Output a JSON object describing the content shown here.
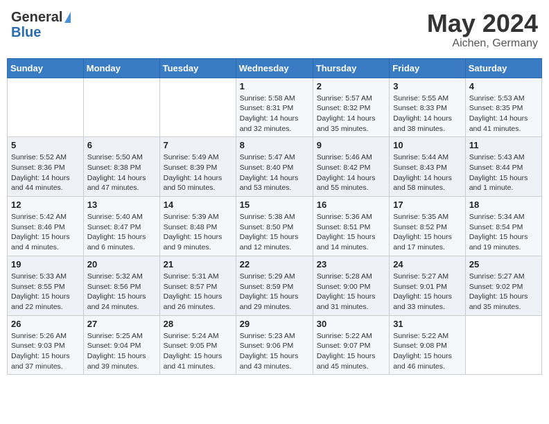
{
  "header": {
    "logo_general": "General",
    "logo_blue": "Blue",
    "month_title": "May 2024",
    "location": "Aichen, Germany"
  },
  "days_of_week": [
    "Sunday",
    "Monday",
    "Tuesday",
    "Wednesday",
    "Thursday",
    "Friday",
    "Saturday"
  ],
  "weeks": [
    [
      {
        "num": "",
        "info": ""
      },
      {
        "num": "",
        "info": ""
      },
      {
        "num": "",
        "info": ""
      },
      {
        "num": "1",
        "info": "Sunrise: 5:58 AM\nSunset: 8:31 PM\nDaylight: 14 hours and 32 minutes."
      },
      {
        "num": "2",
        "info": "Sunrise: 5:57 AM\nSunset: 8:32 PM\nDaylight: 14 hours and 35 minutes."
      },
      {
        "num": "3",
        "info": "Sunrise: 5:55 AM\nSunset: 8:33 PM\nDaylight: 14 hours and 38 minutes."
      },
      {
        "num": "4",
        "info": "Sunrise: 5:53 AM\nSunset: 8:35 PM\nDaylight: 14 hours and 41 minutes."
      }
    ],
    [
      {
        "num": "5",
        "info": "Sunrise: 5:52 AM\nSunset: 8:36 PM\nDaylight: 14 hours and 44 minutes."
      },
      {
        "num": "6",
        "info": "Sunrise: 5:50 AM\nSunset: 8:38 PM\nDaylight: 14 hours and 47 minutes."
      },
      {
        "num": "7",
        "info": "Sunrise: 5:49 AM\nSunset: 8:39 PM\nDaylight: 14 hours and 50 minutes."
      },
      {
        "num": "8",
        "info": "Sunrise: 5:47 AM\nSunset: 8:40 PM\nDaylight: 14 hours and 53 minutes."
      },
      {
        "num": "9",
        "info": "Sunrise: 5:46 AM\nSunset: 8:42 PM\nDaylight: 14 hours and 55 minutes."
      },
      {
        "num": "10",
        "info": "Sunrise: 5:44 AM\nSunset: 8:43 PM\nDaylight: 14 hours and 58 minutes."
      },
      {
        "num": "11",
        "info": "Sunrise: 5:43 AM\nSunset: 8:44 PM\nDaylight: 15 hours and 1 minute."
      }
    ],
    [
      {
        "num": "12",
        "info": "Sunrise: 5:42 AM\nSunset: 8:46 PM\nDaylight: 15 hours and 4 minutes."
      },
      {
        "num": "13",
        "info": "Sunrise: 5:40 AM\nSunset: 8:47 PM\nDaylight: 15 hours and 6 minutes."
      },
      {
        "num": "14",
        "info": "Sunrise: 5:39 AM\nSunset: 8:48 PM\nDaylight: 15 hours and 9 minutes."
      },
      {
        "num": "15",
        "info": "Sunrise: 5:38 AM\nSunset: 8:50 PM\nDaylight: 15 hours and 12 minutes."
      },
      {
        "num": "16",
        "info": "Sunrise: 5:36 AM\nSunset: 8:51 PM\nDaylight: 15 hours and 14 minutes."
      },
      {
        "num": "17",
        "info": "Sunrise: 5:35 AM\nSunset: 8:52 PM\nDaylight: 15 hours and 17 minutes."
      },
      {
        "num": "18",
        "info": "Sunrise: 5:34 AM\nSunset: 8:54 PM\nDaylight: 15 hours and 19 minutes."
      }
    ],
    [
      {
        "num": "19",
        "info": "Sunrise: 5:33 AM\nSunset: 8:55 PM\nDaylight: 15 hours and 22 minutes."
      },
      {
        "num": "20",
        "info": "Sunrise: 5:32 AM\nSunset: 8:56 PM\nDaylight: 15 hours and 24 minutes."
      },
      {
        "num": "21",
        "info": "Sunrise: 5:31 AM\nSunset: 8:57 PM\nDaylight: 15 hours and 26 minutes."
      },
      {
        "num": "22",
        "info": "Sunrise: 5:29 AM\nSunset: 8:59 PM\nDaylight: 15 hours and 29 minutes."
      },
      {
        "num": "23",
        "info": "Sunrise: 5:28 AM\nSunset: 9:00 PM\nDaylight: 15 hours and 31 minutes."
      },
      {
        "num": "24",
        "info": "Sunrise: 5:27 AM\nSunset: 9:01 PM\nDaylight: 15 hours and 33 minutes."
      },
      {
        "num": "25",
        "info": "Sunrise: 5:27 AM\nSunset: 9:02 PM\nDaylight: 15 hours and 35 minutes."
      }
    ],
    [
      {
        "num": "26",
        "info": "Sunrise: 5:26 AM\nSunset: 9:03 PM\nDaylight: 15 hours and 37 minutes."
      },
      {
        "num": "27",
        "info": "Sunrise: 5:25 AM\nSunset: 9:04 PM\nDaylight: 15 hours and 39 minutes."
      },
      {
        "num": "28",
        "info": "Sunrise: 5:24 AM\nSunset: 9:05 PM\nDaylight: 15 hours and 41 minutes."
      },
      {
        "num": "29",
        "info": "Sunrise: 5:23 AM\nSunset: 9:06 PM\nDaylight: 15 hours and 43 minutes."
      },
      {
        "num": "30",
        "info": "Sunrise: 5:22 AM\nSunset: 9:07 PM\nDaylight: 15 hours and 45 minutes."
      },
      {
        "num": "31",
        "info": "Sunrise: 5:22 AM\nSunset: 9:08 PM\nDaylight: 15 hours and 46 minutes."
      },
      {
        "num": "",
        "info": ""
      }
    ]
  ]
}
